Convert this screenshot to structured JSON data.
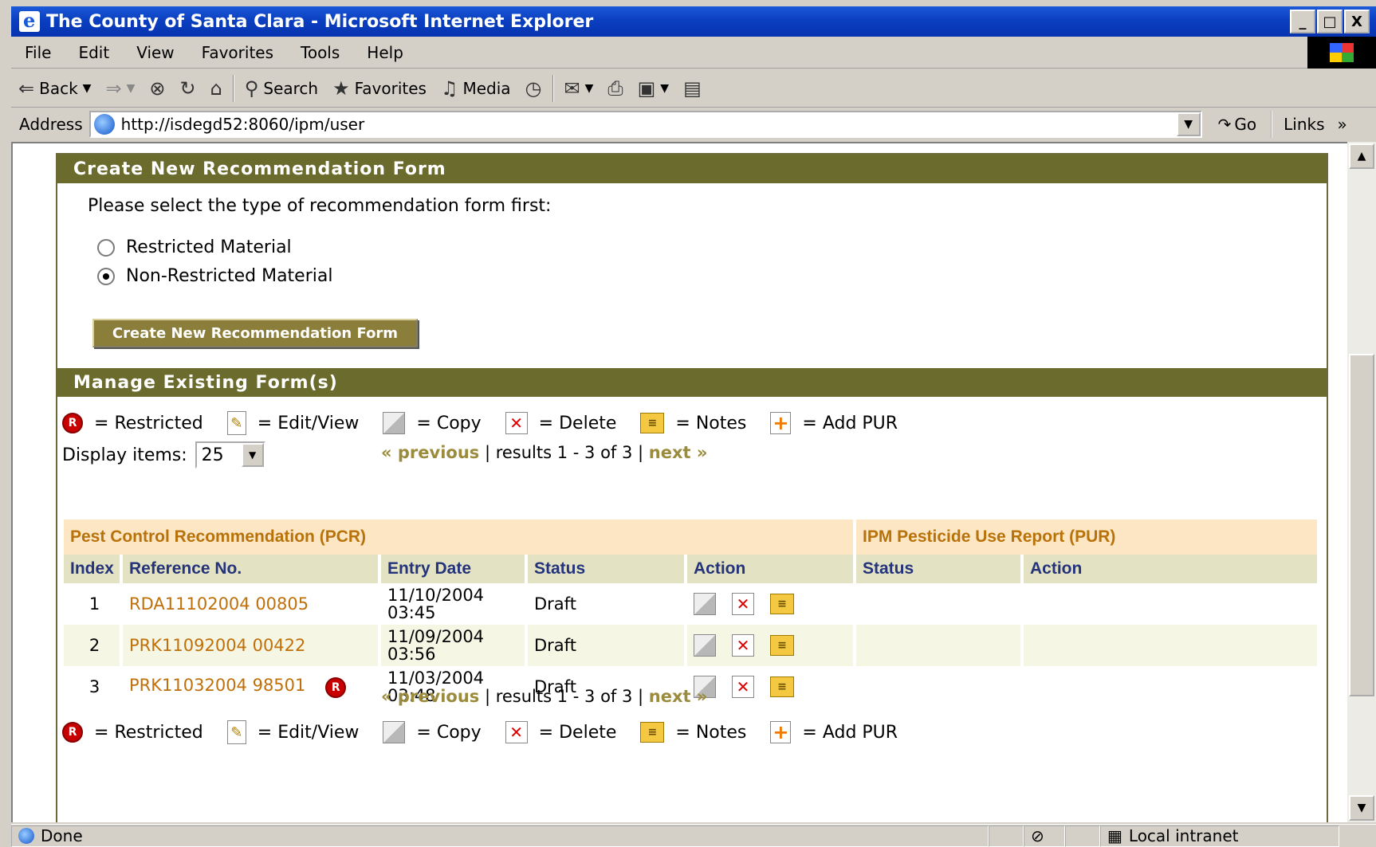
{
  "window": {
    "title": "The County of Santa Clara - Microsoft Internet Explorer",
    "controls": [
      "_",
      "□",
      "X"
    ]
  },
  "menu": [
    "File",
    "Edit",
    "View",
    "Favorites",
    "Tools",
    "Help"
  ],
  "toolbar": {
    "back": "Back",
    "search": "Search",
    "favorites": "Favorites",
    "media": "Media"
  },
  "address": {
    "label": "Address",
    "url": "http://isdegd52:8060/ipm/user",
    "go": "Go",
    "links": "Links",
    "links_more": "»"
  },
  "create_section": {
    "header": "Create New Recommendation Form",
    "prompt": "Please select the type of recommendation form first:",
    "options": [
      {
        "label": "Restricted Material",
        "checked": false
      },
      {
        "label": "Non-Restricted Material",
        "checked": true
      }
    ],
    "button": "Create New Recommendation Form"
  },
  "manage_section": {
    "header": "Manage Existing Form(s)",
    "legend": [
      {
        "icon": "restricted-icon",
        "label": "Restricted"
      },
      {
        "icon": "edit-view-icon",
        "label": "Edit/View"
      },
      {
        "icon": "copy-icon",
        "label": "Copy"
      },
      {
        "icon": "delete-icon",
        "label": "Delete"
      },
      {
        "icon": "notes-icon",
        "label": "Notes"
      },
      {
        "icon": "add-pur-icon",
        "label": "Add PUR"
      }
    ],
    "legend_eq": "=",
    "display_items_label": "Display items:",
    "display_items_value": "25",
    "pager": {
      "previous": "« previous",
      "results": "| results 1 - 3 of 3 |",
      "next": "next »"
    }
  },
  "table": {
    "groups": [
      "Pest Control Recommendation (PCR)",
      "IPM Pesticide Use Report (PUR)"
    ],
    "columns": [
      "Index",
      "Reference No.",
      "Entry Date",
      "Status",
      "Action",
      "Status",
      "Action"
    ],
    "rows": [
      {
        "index": "1",
        "ref": "RDA11102004 00805",
        "date": "11/10/2004",
        "time": "03:45",
        "status": "Draft",
        "restricted": false
      },
      {
        "index": "2",
        "ref": "PRK11092004 00422",
        "date": "11/09/2004",
        "time": "03:56",
        "status": "Draft",
        "restricted": false
      },
      {
        "index": "3",
        "ref": "PRK11032004 98501",
        "date": "11/03/2004",
        "time": "03:48",
        "status": "Draft",
        "restricted": true
      }
    ]
  },
  "status_bar": {
    "text": "Done",
    "zone": "Local intranet"
  },
  "colors": {
    "section_header": "#6b6b2e",
    "group_header_bg": "#fde6c4",
    "group_header_text": "#b8720a",
    "column_header_bg": "#e3e3c4",
    "column_header_text": "#24337a",
    "reference_link": "#c0700a",
    "pager_link": "#9b8b3c"
  }
}
